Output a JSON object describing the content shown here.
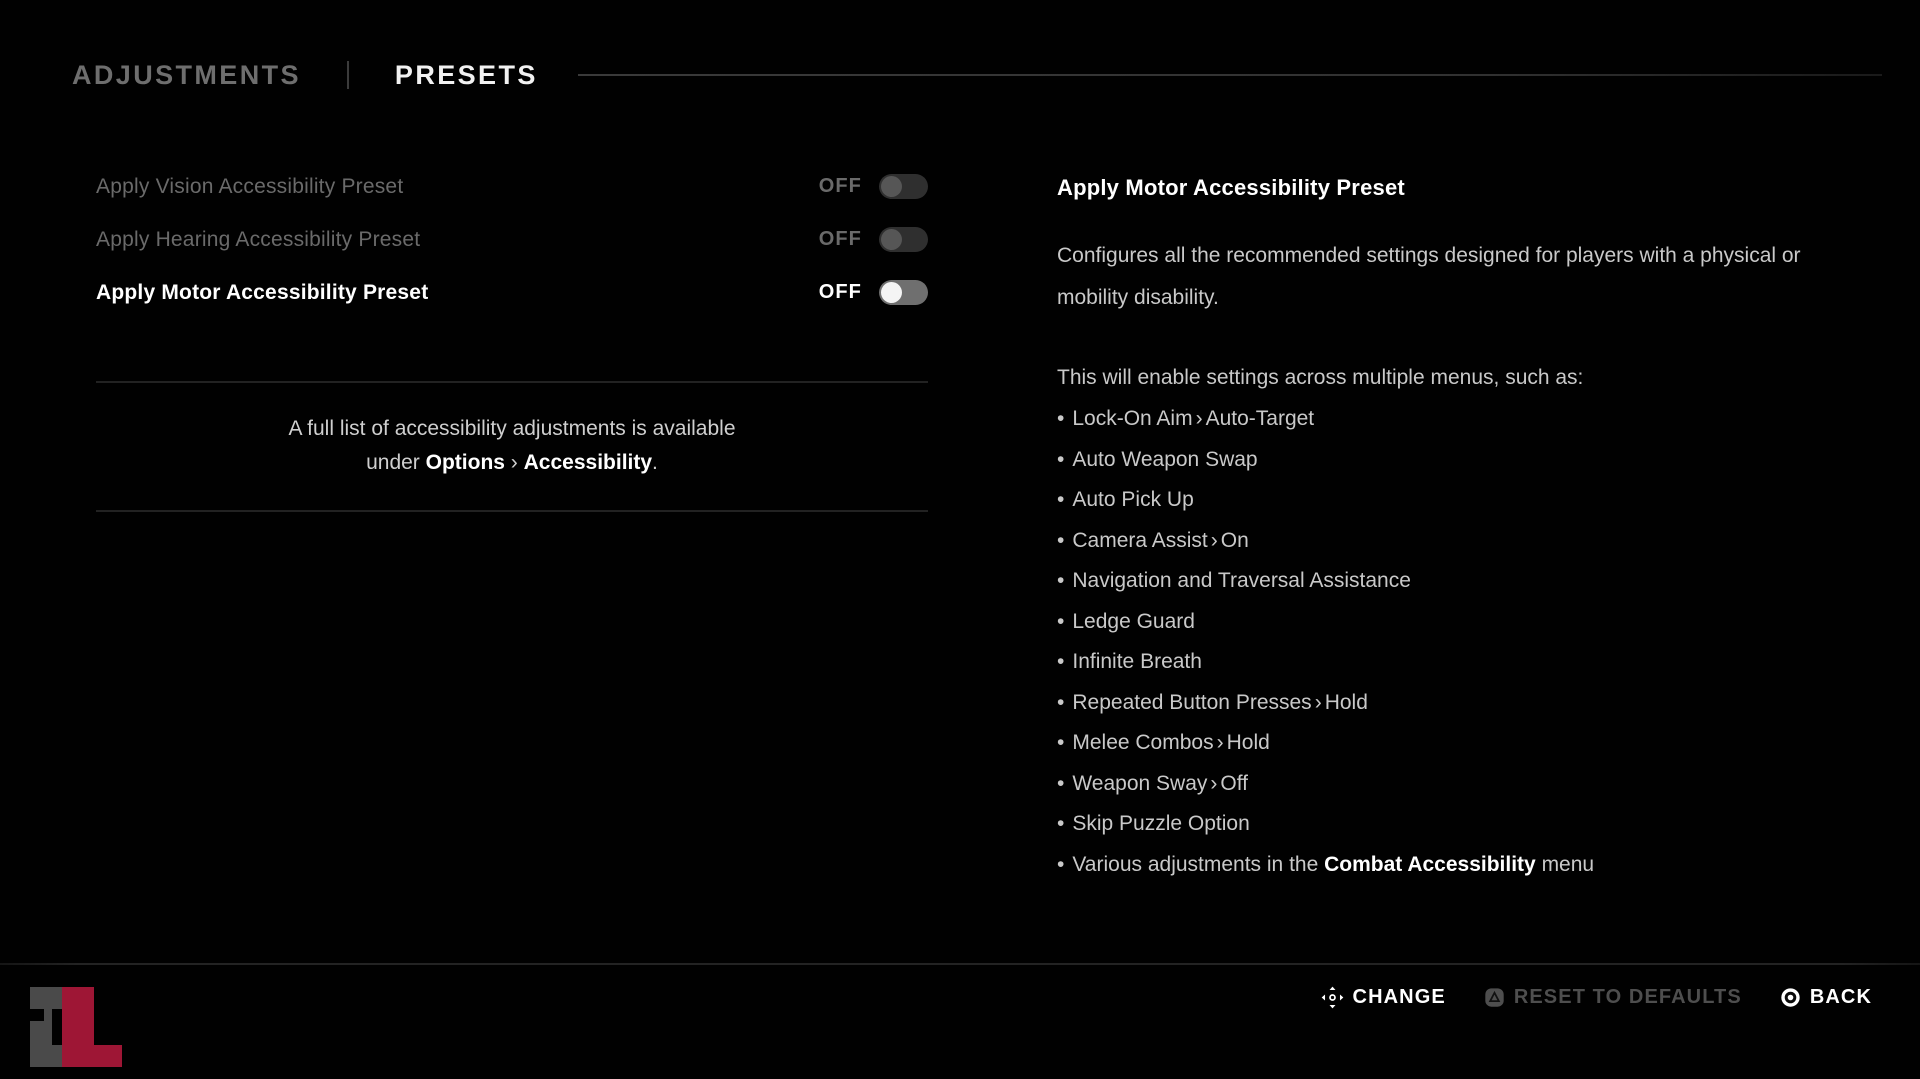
{
  "tabs": {
    "inactive_label": "ADJUSTMENTS",
    "active_label": "PRESETS"
  },
  "settings": [
    {
      "label": "Apply Vision Accessibility Preset",
      "value": "OFF",
      "state": "dim"
    },
    {
      "label": "Apply Hearing Accessibility Preset",
      "value": "OFF",
      "state": "dim"
    },
    {
      "label": "Apply Motor Accessibility Preset",
      "value": "OFF",
      "state": "active"
    }
  ],
  "hint": {
    "line1": "A full list of accessibility adjustments is available",
    "line2_prefix": "under ",
    "line2_bold1": "Options",
    "line2_sep": " › ",
    "line2_bold2": "Accessibility",
    "line2_suffix": "."
  },
  "detail": {
    "title": "Apply Motor Accessibility Preset",
    "paragraph": "Configures all the recommended settings designed for players with a physical or mobility disability.",
    "list_intro": "This will enable settings across multiple menus, such as:",
    "bullets": [
      {
        "text": "Lock-On Aim",
        "sep": "›",
        "value": "Auto-Target"
      },
      {
        "text": "Auto Weapon Swap"
      },
      {
        "text": "Auto Pick Up"
      },
      {
        "text": "Camera Assist",
        "sep": "›",
        "value": "On"
      },
      {
        "text": "Navigation and Traversal Assistance"
      },
      {
        "text": "Ledge Guard"
      },
      {
        "text": "Infinite Breath"
      },
      {
        "text": "Repeated Button Presses",
        "sep": "›",
        "value": "Hold"
      },
      {
        "text": "Melee Combos",
        "sep": "›",
        "value": "Hold"
      },
      {
        "text": "Weapon Sway",
        "sep": "›",
        "value": "Off"
      },
      {
        "text": "Skip Puzzle Option"
      },
      {
        "text": "Various adjustments in the ",
        "bold": "Combat Accessibility",
        "tail": " menu"
      }
    ]
  },
  "prompts": [
    {
      "label": "CHANGE",
      "icon": "dpad-icon",
      "state": "enabled"
    },
    {
      "label": "RESET TO DEFAULTS",
      "icon": "triangle-button-icon",
      "state": "disabled"
    },
    {
      "label": "BACK",
      "icon": "circle-button-icon",
      "state": "enabled"
    }
  ],
  "logo": {
    "name": "zl-logo",
    "grey": "#4a4a4a",
    "crimson": "#9e1635"
  },
  "colors": {
    "background": "#010101",
    "text_primary": "#ffffff",
    "text_secondary": "#c9c9c9",
    "text_dim": "#6a6a6a",
    "divider": "#222222"
  }
}
